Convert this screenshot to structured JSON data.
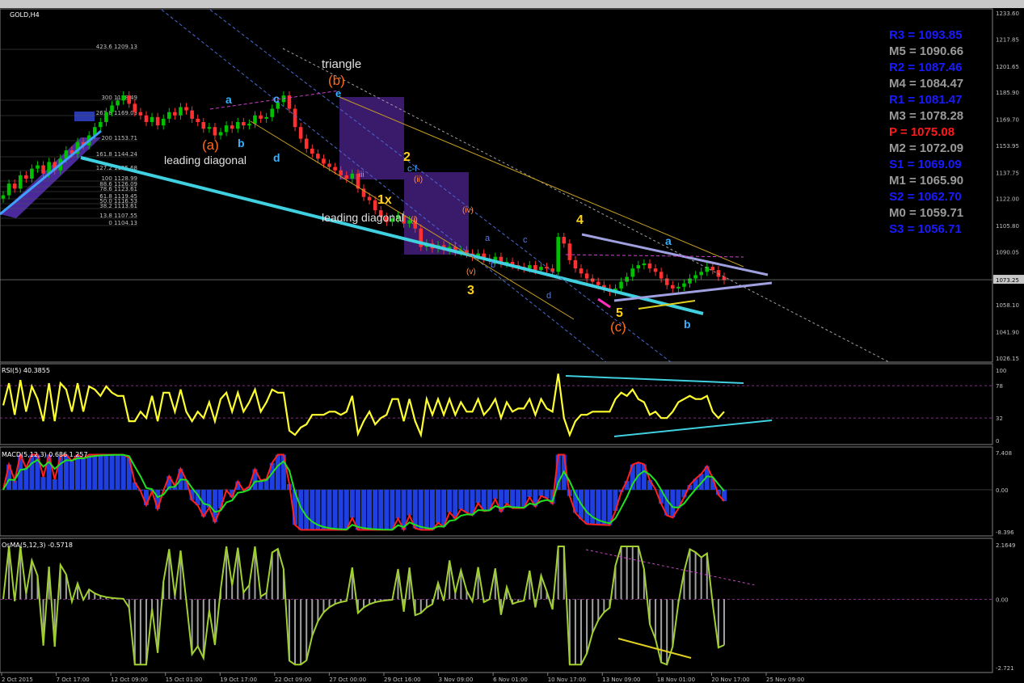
{
  "symbol": "GOLD,H4",
  "pivots": [
    {
      "label": "R3 = 1093.85",
      "color": "#1a1aff"
    },
    {
      "label": "M5 = 1090.66",
      "color": "#9a9a9a"
    },
    {
      "label": "R2 = 1087.46",
      "color": "#1a1aff"
    },
    {
      "label": "M4 = 1084.47",
      "color": "#9a9a9a"
    },
    {
      "label": "R1 = 1081.47",
      "color": "#1a1aff"
    },
    {
      "label": "M3 = 1078.28",
      "color": "#9a9a9a"
    },
    {
      "label": "P  = 1075.08",
      "color": "#ff1a1a"
    },
    {
      "label": "M2 = 1072.09",
      "color": "#9a9a9a"
    },
    {
      "label": "S1 = 1069.09",
      "color": "#1a1aff"
    },
    {
      "label": "M1 = 1065.90",
      "color": "#9a9a9a"
    },
    {
      "label": "S2 = 1062.70",
      "color": "#1a1aff"
    },
    {
      "label": "M0 = 1059.71",
      "color": "#9a9a9a"
    },
    {
      "label": "S3 = 1056.71",
      "color": "#1a1aff"
    }
  ],
  "fib_levels": [
    "423.6 1209.13",
    "300 1178.49",
    "261.8 1169.03",
    "200 1153.71",
    "161.8 1144.24",
    "127.2 1135.68",
    "100 1128.99",
    "88.6 1126.09",
    "78.6 1123.61",
    "61.8 1119.45",
    "50.0 1116.53",
    "38.2 1113.61",
    "13.8 1107.55",
    "0 1104.13"
  ],
  "annotations": {
    "triangle": "triangle",
    "b_paren": "(b)",
    "a_paren": "(a)",
    "c_paren": "(c)",
    "leading_diagonal_1": "leading diagonal",
    "leading_diagonal_2": "leading diagonal",
    "w2": "2",
    "w1x": "1x",
    "w3": "3",
    "w4": "4",
    "w5": "5",
    "a1": "a",
    "b1": "b",
    "c1": "c",
    "d1": "d",
    "e1": "e",
    "a2": "a",
    "b2": "b",
    "c2": "c",
    "d2": "d",
    "a3": "a",
    "b3": "b",
    "cf": "c-f",
    "iv": "(iv)",
    "v": "(v)",
    "ii": "(ii)",
    "i": "(i)",
    "iii": "iii"
  },
  "rsi_label": "RSI(5) 40.3855",
  "macd_label": "MACD(5,12,3) 0.686 1.257",
  "osma_label": "OsMA(5,12,3) -0.5718",
  "chart_data": [
    {
      "type": "line",
      "title": "GOLD,H4",
      "ylim": [
        1026.15,
        1233.6
      ],
      "y_ticks": [
        1233.6,
        1217.85,
        1201.65,
        1185.9,
        1169.7,
        1153.95,
        1137.75,
        1122.0,
        1105.8,
        1090.05,
        1073.25,
        1058.1,
        1041.9,
        1026.15
      ],
      "current_price": 1073.25,
      "x_tick_labels": [
        "2 Oct 2015",
        "7 Oct 17:00",
        "12 Oct 09:00",
        "15 Oct 01:00",
        "19 Oct 17:00",
        "22 Oct 09:00",
        "27 Oct 00:00",
        "29 Oct 16:00",
        "3 Nov 09:00",
        "6 Nov 01:00",
        "10 Nov 17:00",
        "13 Nov 09:00",
        "18 Nov 01:00",
        "20 Nov 17:00",
        "25 Nov 09:00"
      ],
      "close": [
        1124,
        1131,
        1128,
        1136,
        1134,
        1140,
        1142,
        1137,
        1144,
        1139,
        1146,
        1151,
        1149,
        1156,
        1154,
        1160,
        1165,
        1168,
        1174,
        1178,
        1181,
        1184,
        1179,
        1174,
        1172,
        1168,
        1171,
        1166,
        1170,
        1174,
        1172,
        1177,
        1175,
        1170,
        1168,
        1164,
        1165,
        1160,
        1162,
        1166,
        1164,
        1168,
        1166,
        1167,
        1172,
        1170,
        1171,
        1176,
        1180,
        1184,
        1176,
        1165,
        1158,
        1152,
        1149,
        1146,
        1143,
        1141,
        1139,
        1136,
        1134,
        1137,
        1128,
        1123,
        1121,
        1115,
        1111,
        1108,
        1110,
        1112,
        1107,
        1109,
        1104,
        1093,
        1095,
        1092,
        1094,
        1091,
        1093,
        1090,
        1091,
        1089,
        1087,
        1089,
        1086,
        1085,
        1087,
        1083,
        1084,
        1082,
        1081,
        1080,
        1082,
        1079,
        1081,
        1080,
        1078,
        1099,
        1095,
        1085,
        1080,
        1077,
        1074,
        1072,
        1070,
        1068,
        1066,
        1068,
        1072,
        1075,
        1080,
        1082,
        1083,
        1080,
        1078,
        1074,
        1070,
        1068,
        1069,
        1071,
        1074,
        1076,
        1078,
        1081,
        1079,
        1075,
        1073
      ]
    },
    {
      "type": "line",
      "title": "RSI(5) 40.3855",
      "ylim": [
        0,
        100
      ],
      "y_ticks": [
        100,
        78,
        32,
        0
      ]
    },
    {
      "type": "bar",
      "title": "MACD(5,12,3) 0.686 1.257",
      "ylim": [
        -8.396,
        7.408
      ],
      "y_ticks": [
        7.408,
        0.0,
        -8.396
      ]
    },
    {
      "type": "bar",
      "title": "OsMA(5,12,3) -0.5718",
      "ylim": [
        -2.721,
        2.1649
      ],
      "y_ticks": [
        2.1649,
        0.0,
        -2.721
      ]
    }
  ]
}
